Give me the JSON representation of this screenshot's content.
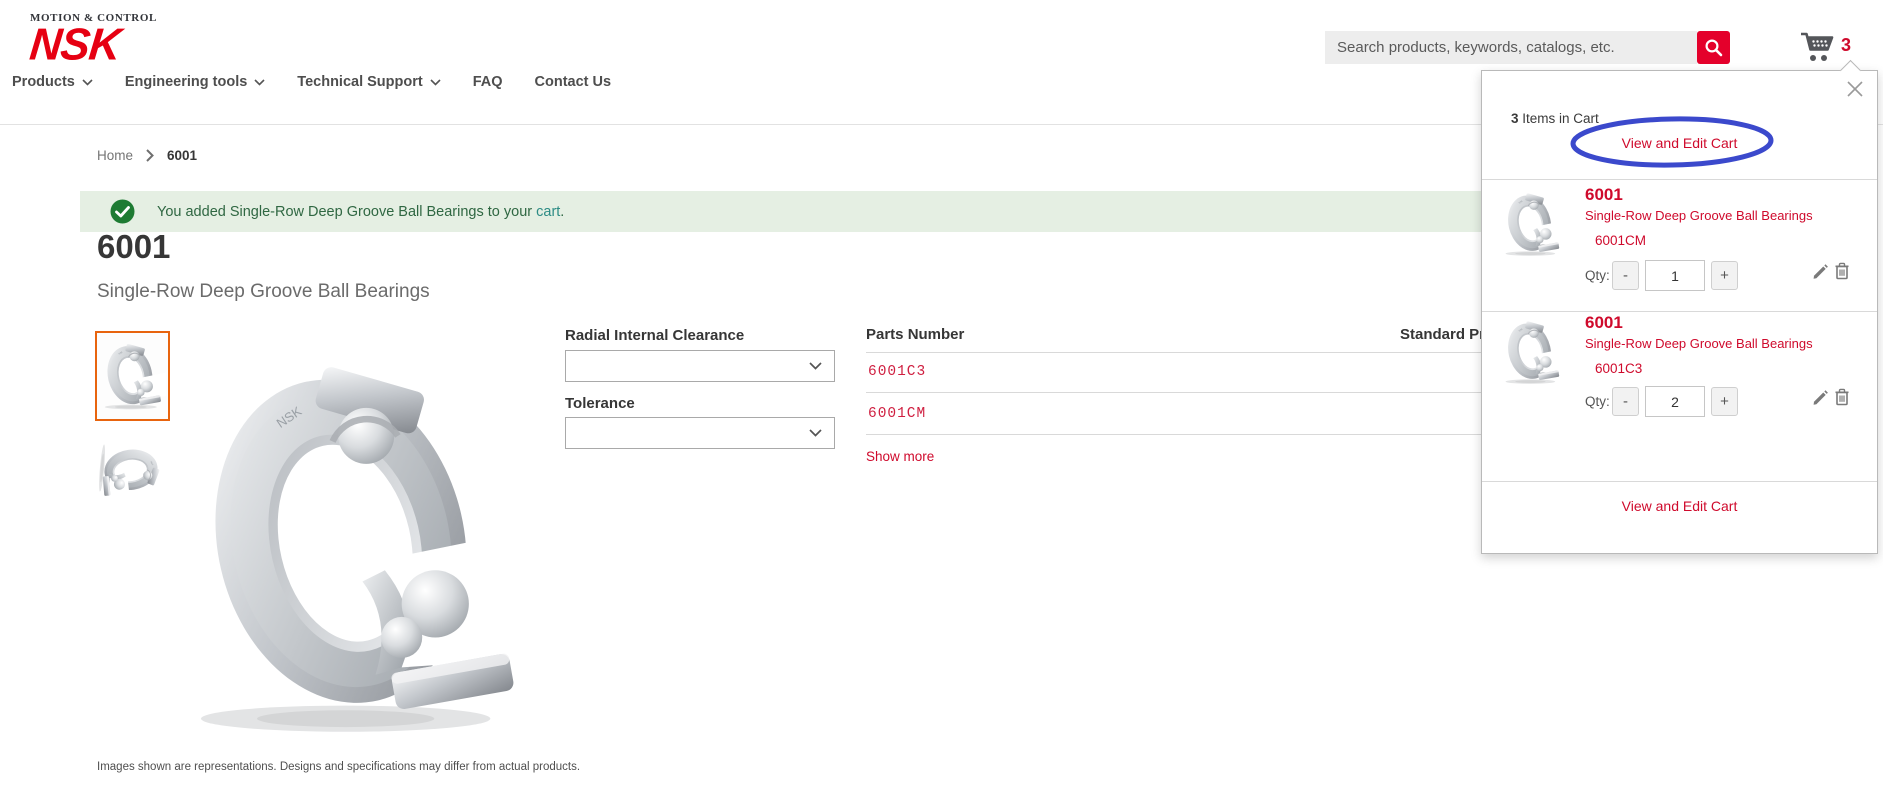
{
  "header": {
    "logo_tagline": "MOTION & CONTROL",
    "logo_brand": "NSK",
    "nav": {
      "products": "Products",
      "engineering_tools": "Engineering tools",
      "technical_support": "Technical Support",
      "faq": "FAQ",
      "contact_us": "Contact Us"
    },
    "search_placeholder": "Search products, keywords, catalogs, etc.",
    "cart_count": "3"
  },
  "breadcrumb": {
    "home": "Home",
    "current": "6001"
  },
  "success_message": {
    "text": "You added Single-Row Deep Groove Ball Bearings to your ",
    "link": "cart",
    "period": "."
  },
  "product": {
    "title": "6001",
    "subtitle": "Single-Row Deep Groove Ball Bearings",
    "disclaimer": "Images shown are representations. Designs and specifications may differ from actual products."
  },
  "options": {
    "clearance_label": "Radial Internal Clearance",
    "tolerance_label": "Tolerance"
  },
  "parts_table": {
    "col_parts": "Parts Number",
    "col_price": "Standard Pri",
    "rows": [
      {
        "part": "6001C3"
      },
      {
        "part": "6001CM"
      }
    ],
    "show_more": "Show more"
  },
  "cart_popup": {
    "count": "3",
    "count_suffix": " Items in Cart",
    "view_edit_top": "View and Edit Cart",
    "view_edit_bottom": "View and Edit Cart",
    "qty_label": "Qty:",
    "minus": "-",
    "plus": "+",
    "items": [
      {
        "title": "6001",
        "subtitle": "Single-Row Deep Groove Ball Bearings",
        "part": "6001CM",
        "qty": "1"
      },
      {
        "title": "6001",
        "subtitle": "Single-Row Deep Groove Ball Bearings",
        "part": "6001C3",
        "qty": "2"
      }
    ]
  },
  "icons": {
    "search": "magnifier",
    "cart": "shopping-cart",
    "close": "x-cross",
    "check": "checkmark-circle",
    "chevron_down": "chevron-down",
    "breadcrumb_chevron": "chevron-right",
    "edit": "pencil",
    "delete": "trash-can"
  },
  "colors": {
    "brand_red": "#e60012",
    "search_button_red": "#e4002b",
    "link_red": "#cf0a2c",
    "part_number_red": "#cf1f40",
    "success_bg": "#e5efe3",
    "success_icon_green": "#1e7b33",
    "success_text_green": "#2f6742",
    "cart_link_teal": "#2d8c85",
    "annotation_blue": "#3b49cc",
    "selected_thumb_orange": "#e8640e"
  }
}
